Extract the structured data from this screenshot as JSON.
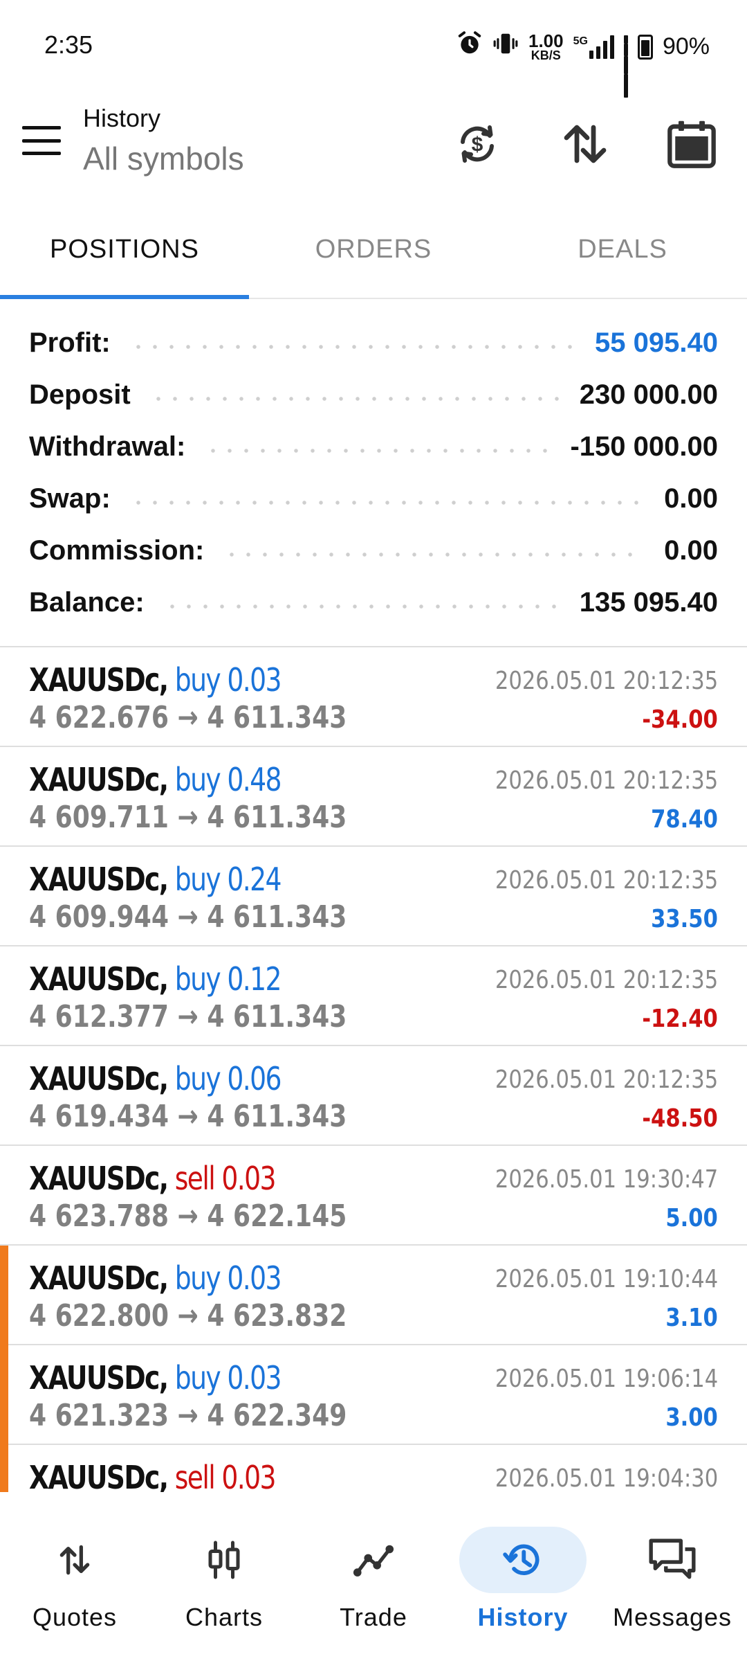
{
  "status_bar": {
    "time": "2:35",
    "net_speed_value": "1.00",
    "net_speed_unit": "KB/S",
    "network_type": "5G",
    "battery_pct": "90%"
  },
  "header": {
    "title": "History",
    "subtitle": "All symbols",
    "buttons": [
      "currency-exchange-icon",
      "sort-icon",
      "calendar-icon"
    ]
  },
  "tabs": [
    {
      "label": "POSITIONS",
      "active": true
    },
    {
      "label": "ORDERS",
      "active": false
    },
    {
      "label": "DEALS",
      "active": false
    }
  ],
  "summary": {
    "profit_label": "Profit:",
    "profit_value": "55 095.40",
    "deposit_label": "Deposit",
    "deposit_value": "230 000.00",
    "withdrawal_label": "Withdrawal:",
    "withdrawal_value": "-150 000.00",
    "swap_label": "Swap:",
    "swap_value": "0.00",
    "commission_label": "Commission:",
    "commission_value": "0.00",
    "balance_label": "Balance:",
    "balance_value": "135 095.40"
  },
  "positions": [
    {
      "symbol": "XAUUSDc,",
      "side": "buy 0.03",
      "prices": "4 622.676 → 4 611.343",
      "time": "2026.05.01 20:12:35",
      "profit": "-34.00"
    },
    {
      "symbol": "XAUUSDc,",
      "side": "buy 0.48",
      "prices": "4 609.711 → 4 611.343",
      "time": "2026.05.01 20:12:35",
      "profit": "78.40"
    },
    {
      "symbol": "XAUUSDc,",
      "side": "buy 0.24",
      "prices": "4 609.944 → 4 611.343",
      "time": "2026.05.01 20:12:35",
      "profit": "33.50"
    },
    {
      "symbol": "XAUUSDc,",
      "side": "buy 0.12",
      "prices": "4 612.377 → 4 611.343",
      "time": "2026.05.01 20:12:35",
      "profit": "-12.40"
    },
    {
      "symbol": "XAUUSDc,",
      "side": "buy 0.06",
      "prices": "4 619.434 → 4 611.343",
      "time": "2026.05.01 20:12:35",
      "profit": "-48.50"
    },
    {
      "symbol": "XAUUSDc,",
      "side": "sell 0.03",
      "prices": "4 623.788 → 4 622.145",
      "time": "2026.05.01 19:30:47",
      "profit": "5.00"
    },
    {
      "symbol": "XAUUSDc,",
      "side": "buy 0.03",
      "prices": "4 622.800 → 4 623.832",
      "time": "2026.05.01 19:10:44",
      "profit": "3.10"
    },
    {
      "symbol": "XAUUSDc,",
      "side": "buy 0.03",
      "prices": "4 621.323 → 4 622.349",
      "time": "2026.05.01 19:06:14",
      "profit": "3.00"
    },
    {
      "symbol": "XAUUSDc,",
      "side": "sell 0.03",
      "prices": "",
      "time": "2026.05.01 19:04:30",
      "profit": ""
    }
  ],
  "bottom_nav": [
    {
      "label": "Quotes",
      "icon": "quotes-arrows-icon",
      "active": false
    },
    {
      "label": "Charts",
      "icon": "candlestick-icon",
      "active": false
    },
    {
      "label": "Trade",
      "icon": "trade-line-icon",
      "active": false
    },
    {
      "label": "History",
      "icon": "history-clock-icon",
      "active": true
    },
    {
      "label": "Messages",
      "icon": "messages-icon",
      "active": false
    }
  ],
  "colors": {
    "accent_blue": "#1a73d9",
    "loss_red": "#cc1111",
    "marker_orange": "#f07a1c",
    "active_nav_bg": "#e3effb"
  }
}
